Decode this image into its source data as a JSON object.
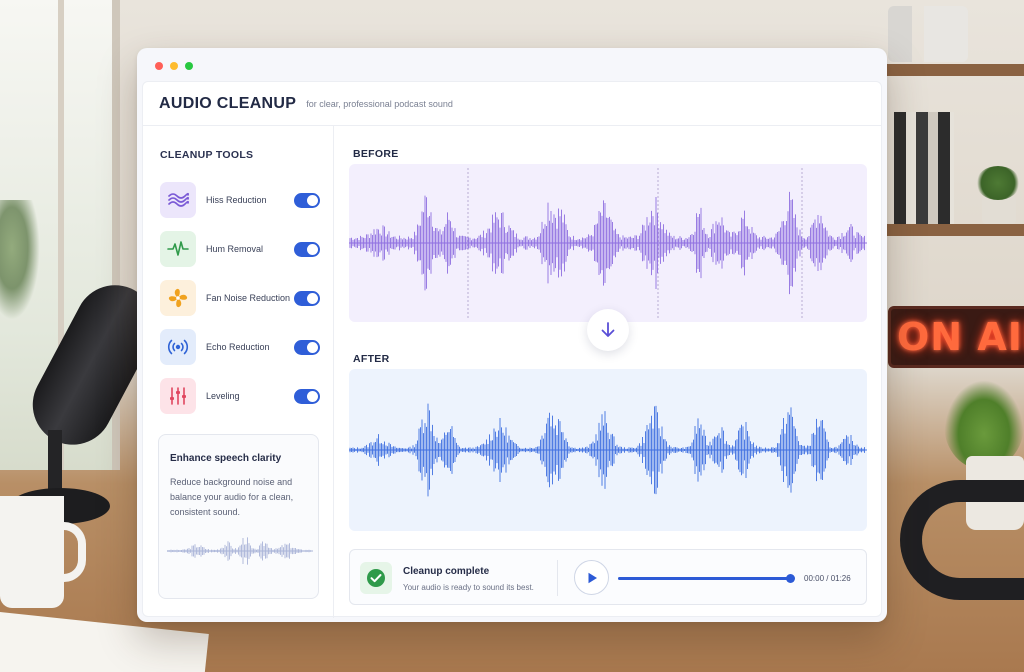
{
  "background": {
    "sign_text": "ON AIR"
  },
  "app": {
    "title": "AUDIO CLEANUP",
    "subtitle": "for clear, professional podcast sound"
  },
  "sidebar": {
    "heading": "CLEANUP TOOLS",
    "tools": [
      {
        "label": "Hiss Reduction",
        "icon": "hiss-wave-icon",
        "enabled": true,
        "icon_bg": "#ece6fb",
        "icon_color": "#7b5ad6"
      },
      {
        "label": "Hum Removal",
        "icon": "pulse-icon",
        "enabled": true,
        "icon_bg": "#e4f4e6",
        "icon_color": "#2f9a4a"
      },
      {
        "label": "Fan Noise Reduction",
        "icon": "fan-icon",
        "enabled": true,
        "icon_bg": "#fdf0dc",
        "icon_color": "#f0a21f"
      },
      {
        "label": "Echo Reduction",
        "icon": "broadcast-icon",
        "enabled": true,
        "icon_bg": "#e3ecfb",
        "icon_color": "#2f63d6"
      },
      {
        "label": "Leveling",
        "icon": "sliders-icon",
        "enabled": true,
        "icon_bg": "#fde3e8",
        "icon_color": "#e0465f"
      }
    ],
    "enhance": {
      "title": "Enhance speech clarity",
      "body": "Reduce background noise and balance your audio for a clean, consistent sound."
    }
  },
  "main": {
    "before_label": "BEFORE",
    "after_label": "AFTER",
    "status": {
      "title": "Cleanup complete",
      "subtitle": "Your audio is ready to sound its best."
    },
    "player": {
      "progress": 1.0,
      "time": "00:00 / 01:26"
    }
  },
  "colors": {
    "accent": "#2f5ed8",
    "before_wave": "#8f6fe0",
    "after_wave": "#3f6fe0",
    "success": "#2f9a4a"
  }
}
